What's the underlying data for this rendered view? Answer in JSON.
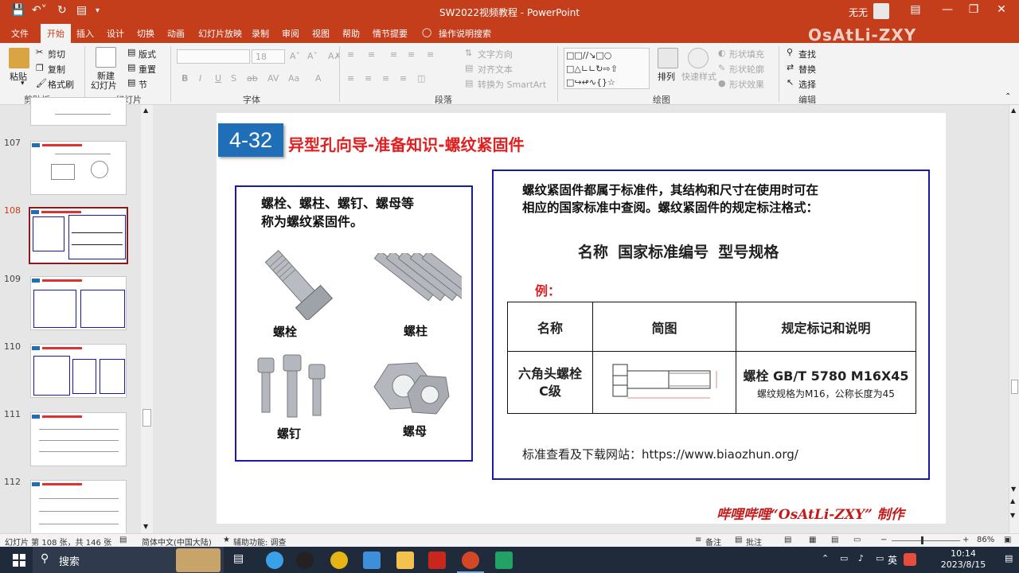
{
  "window": {
    "title": "SW2022视频教程 - PowerPoint",
    "user": "无无",
    "watermark": "OsAtLi-ZXY"
  },
  "quick_access": {
    "save_icon": "save-icon",
    "undo_icon": "undo-icon",
    "redo_icon": "redo-icon"
  },
  "tabs": [
    "文件",
    "开始",
    "插入",
    "设计",
    "切换",
    "动画",
    "幻灯片放映",
    "录制",
    "审阅",
    "视图",
    "帮助",
    "情节提要",
    "操作说明搜索"
  ],
  "ribbon": {
    "clipboard": {
      "paste": "粘贴",
      "cut": "剪切",
      "copy": "复制",
      "format_painter": "格式刷",
      "group": "剪贴板"
    },
    "slides": {
      "new_slide": "新建",
      "new_slide2": "幻灯片",
      "layout": "版式",
      "reset": "重置",
      "section": "节",
      "group": "幻灯片"
    },
    "font": {
      "group": "字体",
      "size": "18"
    },
    "paragraph": {
      "text_direction": "文字方向",
      "align_text": "对齐文本",
      "smartart": "转换为 SmartArt",
      "group": "段落"
    },
    "drawing": {
      "arrange": "排列",
      "quick_styles": "快速样式",
      "shape_fill": "形状填充",
      "shape_outline": "形状轮廓",
      "shape_effects": "形状效果",
      "group": "绘图"
    },
    "editing": {
      "find": "查找",
      "replace": "替换",
      "select": "选择",
      "group": "编辑"
    }
  },
  "thumbnails": [
    {
      "num": "107"
    },
    {
      "num": "108"
    },
    {
      "num": "109"
    },
    {
      "num": "110"
    },
    {
      "num": "111"
    },
    {
      "num": "112"
    }
  ],
  "slide": {
    "number_badge": "4-32",
    "title": "异型孔向导-准备知识-螺纹紧固件",
    "left_intro_line1": "螺栓、螺柱、螺钉、螺母等",
    "left_intro_line2": "称为螺纹紧固件。",
    "parts": {
      "bolt": "螺栓",
      "stud": "螺柱",
      "screw": "螺钉",
      "nut": "螺母"
    },
    "right_text_line1": "螺纹紧固件都属于标准件，其结构和尺寸在使用时可在",
    "right_text_line2": "相应的国家标准中查阅。螺纹紧固件的规定标注格式：",
    "format": {
      "a": "名称",
      "b": "国家标准编号",
      "c": "型号规格"
    },
    "example_label": "例：",
    "table": {
      "headers": [
        "名称",
        "简图",
        "规定标记和说明"
      ],
      "row_name_line1": "六角头螺栓",
      "row_name_line2": "C级",
      "row_mark": "螺栓 GB/T 5780 M16X45",
      "row_desc": "螺纹规格为M16，公称长度为45"
    },
    "site": "标准查看及下载网站：https://www.biaozhun.org/",
    "credit": "哔哩哔哩“OsAtLi-ZXY” 制作"
  },
  "status": {
    "slide_info": "幻灯片 第 108 张，共 146 张",
    "language": "简体中文(中国大陆)",
    "accessibility": "辅助功能: 调查",
    "notes": "备注",
    "comments": "批注",
    "zoom": "86%"
  },
  "taskbar": {
    "search": "搜索",
    "time": "10:14",
    "date": "2023/8/15",
    "ime": "英"
  }
}
